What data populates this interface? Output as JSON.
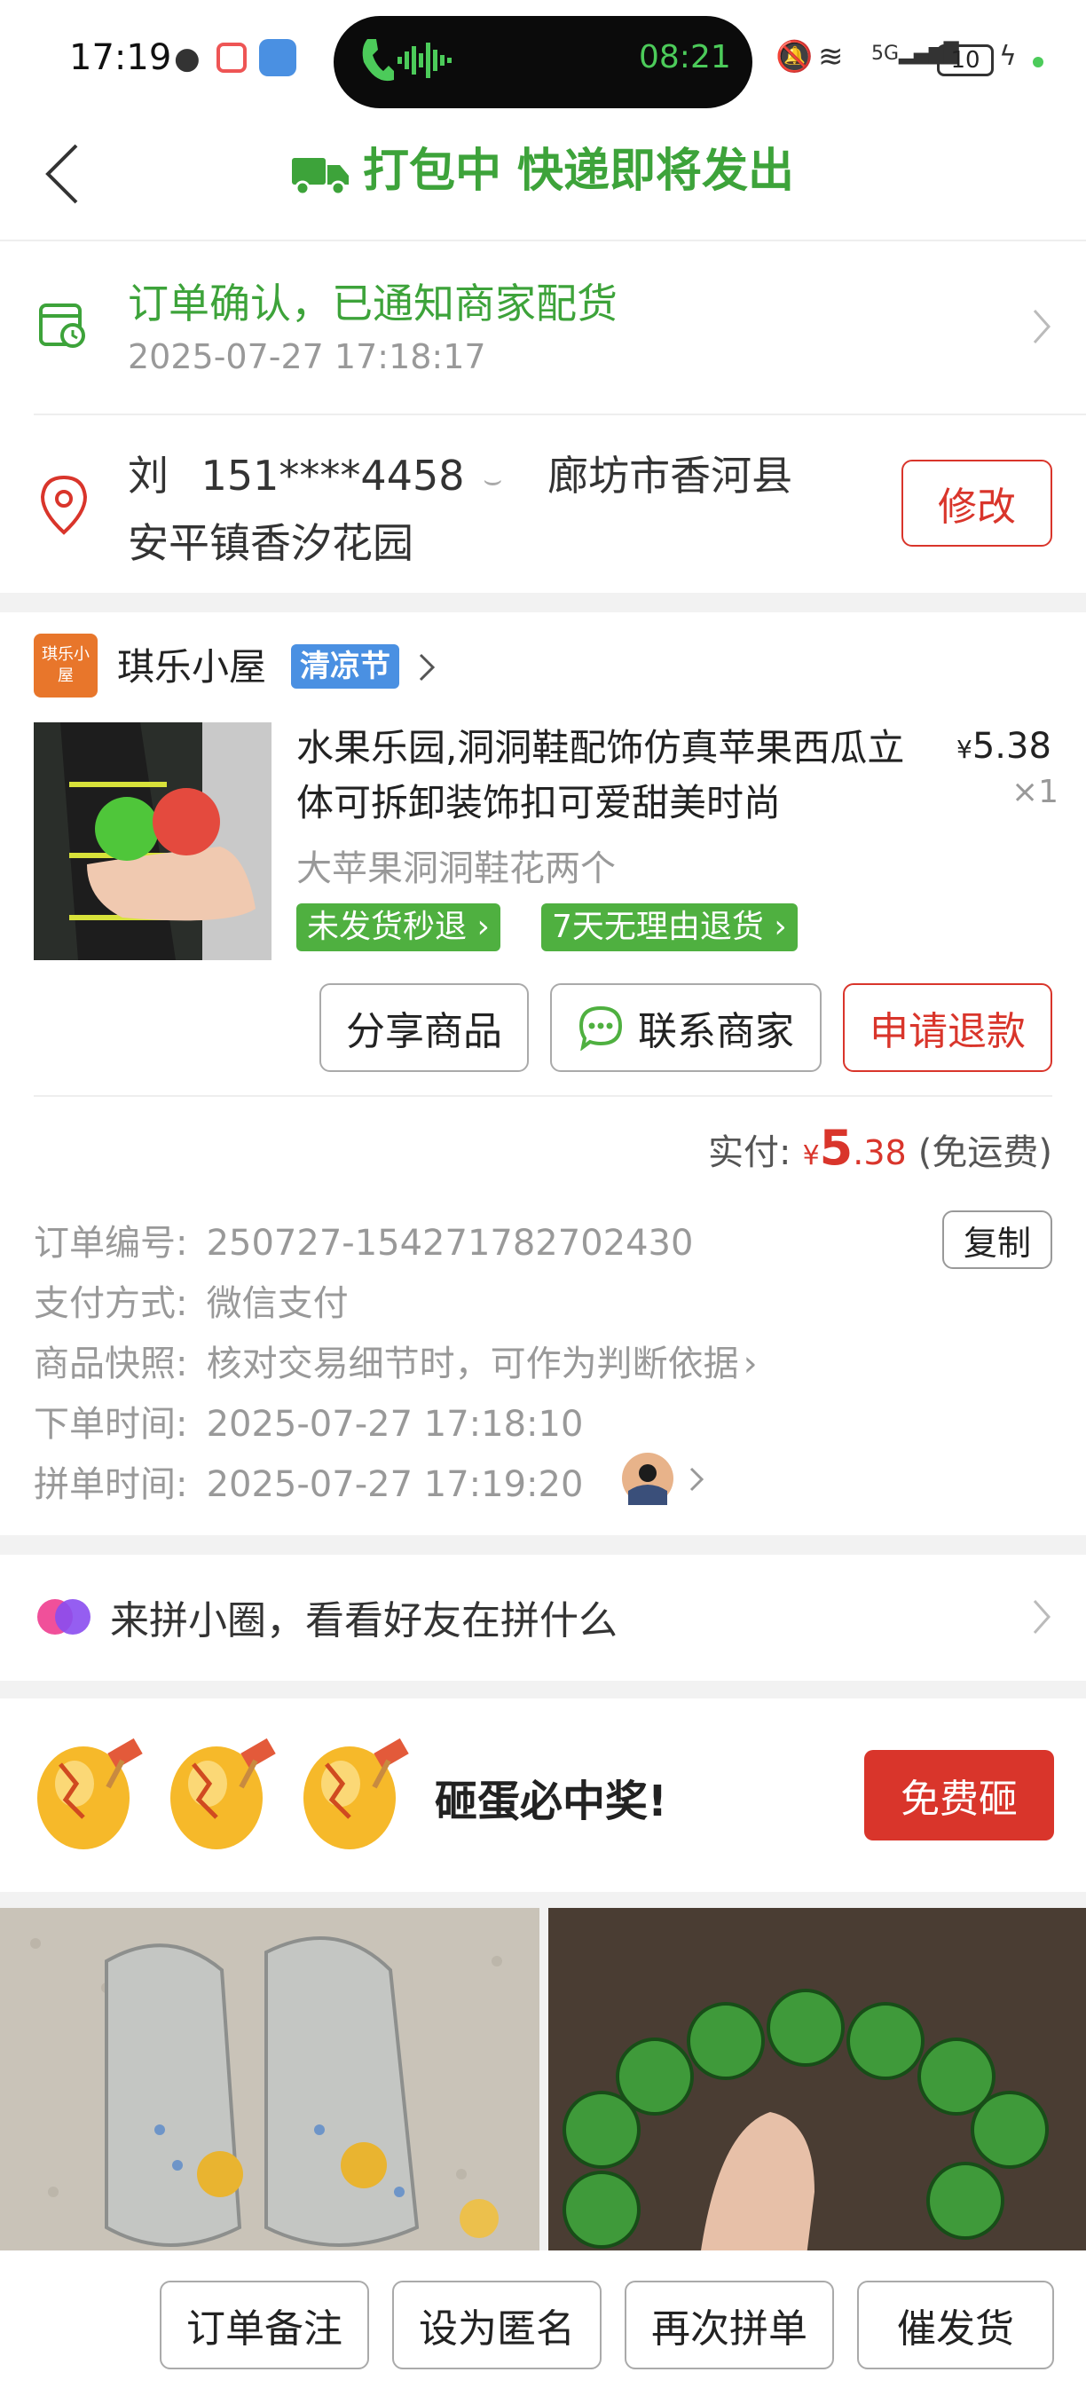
{
  "status_bar": {
    "time": "17:19",
    "call_time": "08:21",
    "battery": "10"
  },
  "header": {
    "title": "打包中 快递即将发出",
    "back_icon": "chevron-left-icon"
  },
  "order_status": {
    "text": "订单确认，已通知商家配货",
    "time": "2025-07-27 17:18:17"
  },
  "address": {
    "name": "刘",
    "phone": "151****4458",
    "region": "廊坊市香河县",
    "detail": "安平镇香汐花园",
    "edit_label": "修改"
  },
  "store": {
    "logo_text": "琪乐小屋",
    "name": "琪乐小屋",
    "badge": "清凉节"
  },
  "product": {
    "title": "水果乐园,洞洞鞋配饰仿真苹果西瓜立体可拆卸装饰扣可爱甜美时尚",
    "price_symbol": "¥",
    "price": "5.38",
    "quantity": "×1",
    "spec": "大苹果洞洞鞋花两个",
    "tags": [
      "未发货秒退",
      "7天无理由退货"
    ]
  },
  "actions": {
    "share": "分享商品",
    "contact": "联系商家",
    "refund": "申请退款"
  },
  "payment": {
    "label": "实付:",
    "symbol": "¥",
    "amount_int": "5",
    "amount_dec": ".38",
    "note": "(免运费)"
  },
  "order_info": {
    "order_no_label": "订单编号:",
    "order_no": "250727-154271782702430",
    "copy_label": "复制",
    "pay_method_label": "支付方式:",
    "pay_method": "微信支付",
    "snapshot_label": "商品快照:",
    "snapshot": "核对交易细节时，可作为判断依据",
    "order_time_label": "下单时间:",
    "order_time": "2025-07-27 17:18:10",
    "group_time_label": "拼单时间:",
    "group_time": "2025-07-27 17:19:20"
  },
  "circle": {
    "text": "来拼小圈，看看好友在拼什么"
  },
  "promo": {
    "text": "砸蛋必中奖!",
    "button": "免费砸"
  },
  "bottom_bar": {
    "note": "订单备注",
    "anonymous": "设为匿名",
    "reorder": "再次拼单",
    "urge": "催发货"
  },
  "colors": {
    "brand_green": "#3da33a",
    "accent_red": "#d9352b",
    "tag_green": "#4fb040",
    "badge_blue": "#4a90e2"
  }
}
